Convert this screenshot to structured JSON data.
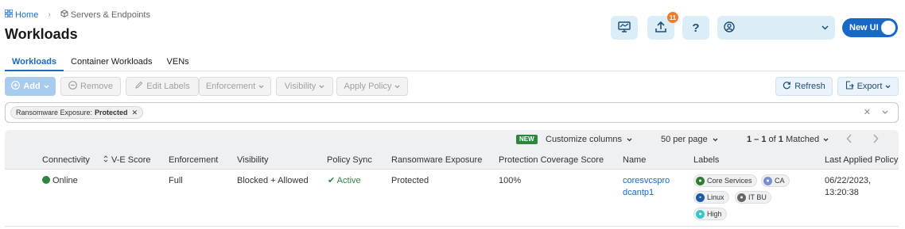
{
  "breadcrumb": {
    "home": "Home",
    "current": "Servers & Endpoints"
  },
  "page_title": "Workloads",
  "header": {
    "notification_count": "11",
    "help": "?",
    "user_name": "",
    "new_ui_label": "New UI"
  },
  "tabs": [
    "Workloads",
    "Container Workloads",
    "VENs"
  ],
  "toolbar": {
    "add": "Add",
    "remove": "Remove",
    "edit_labels": "Edit Labels",
    "enforcement": "Enforcement",
    "visibility": "Visibility",
    "apply_policy": "Apply Policy",
    "refresh": "Refresh",
    "export": "Export"
  },
  "filter": {
    "chip_key": "Ransomware Exposure:",
    "chip_value": "Protected"
  },
  "grid_top": {
    "new_badge": "NEW",
    "customize": "Customize columns",
    "per_page": "50 per page",
    "range": "1 – 1",
    "of": "of",
    "total": "1",
    "matched": "Matched"
  },
  "columns": [
    "Connectivity",
    "V-E Score",
    "Enforcement",
    "Visibility",
    "Policy Sync",
    "Ransomware Exposure",
    "Protection Coverage Score",
    "Name",
    "Labels",
    "Last Applied Policy"
  ],
  "row": {
    "connectivity": "Online",
    "enforcement": "Full",
    "visibility": "Blocked + Allowed",
    "policy_sync": "Active",
    "ransomware": "Protected",
    "coverage": "100%",
    "name_line1": "coresvcspro",
    "name_line2": "dcantp1",
    "labels": {
      "core": "Core Services",
      "ca": "CA",
      "linux": "Linux",
      "itbu": "IT BU",
      "high": "High"
    },
    "last_applied_date": "06/22/2023,",
    "last_applied_time": "13:20:38"
  },
  "colors": {
    "accent": "#1768c7",
    "online": "#2e8540",
    "badge": "#f07c28"
  }
}
